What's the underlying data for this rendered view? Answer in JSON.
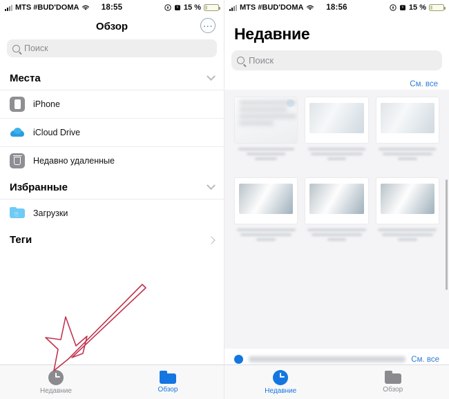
{
  "status_bar": {
    "carrier": "MTS #BUD'DOMA",
    "time_left": "18:55",
    "time_right": "18:56",
    "battery_percent": "15 %",
    "icons": [
      "signal-icon",
      "wifi-icon",
      "location-icon",
      "alarm-icon",
      "battery-icon"
    ]
  },
  "left_panel": {
    "nav_title": "Обзор",
    "more_button": "…",
    "search_placeholder": "Поиск",
    "sections": [
      {
        "title": "Места",
        "chevron": "chevron-down-icon",
        "items": [
          {
            "label": "iPhone",
            "icon": "iphone-icon"
          },
          {
            "label": "iCloud Drive",
            "icon": "cloud-icon"
          },
          {
            "label": "Недавно удаленные",
            "icon": "trash-icon"
          }
        ]
      },
      {
        "title": "Избранные",
        "chevron": "chevron-down-icon",
        "items": [
          {
            "label": "Загрузки",
            "icon": "downloads-folder-icon"
          }
        ]
      },
      {
        "title": "Теги",
        "chevron": "chevron-right-icon",
        "items": []
      }
    ],
    "tabs": [
      {
        "label": "Недавние",
        "icon": "clock-icon",
        "active": false
      },
      {
        "label": "Обзор",
        "icon": "folder-icon",
        "active": true
      }
    ]
  },
  "right_panel": {
    "title": "Недавние",
    "search_placeholder": "Поиск",
    "see_all_top": "См. все",
    "see_all_bottom": "См. все",
    "tabs": [
      {
        "label": "Недавние",
        "icon": "clock-icon",
        "active": true
      },
      {
        "label": "Обзор",
        "icon": "folder-icon",
        "active": false
      }
    ]
  },
  "annotation": {
    "type": "red-arrow",
    "color": "#c0334d",
    "points_to": "recent-tab-left-panel"
  },
  "colors": {
    "accent_blue": "#1476e0",
    "link_blue": "#2e7cd6",
    "inactive_gray": "#8a8a8f",
    "bg_gray": "#f4f4f6"
  }
}
